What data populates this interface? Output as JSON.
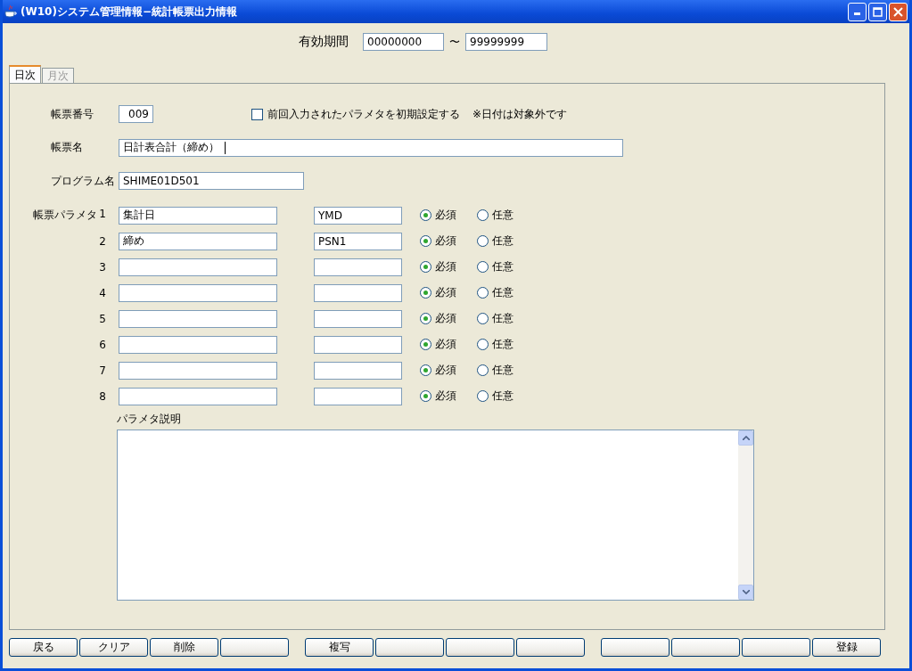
{
  "window": {
    "title": "(W10)システム管理情報−統計帳票出力情報"
  },
  "period": {
    "label": "有効期間",
    "from": "00000000",
    "separator": "〜",
    "to": "99999999"
  },
  "tabs": [
    {
      "label": "日次",
      "selected": true
    },
    {
      "label": "月次",
      "selected": false
    }
  ],
  "form": {
    "report_number": {
      "label": "帳票番号",
      "value": "009"
    },
    "reuse_checkbox": {
      "label": "前回入力されたパラメタを初期設定する",
      "checked": false,
      "note": "※日付は対象外です"
    },
    "report_name": {
      "label": "帳票名",
      "value": "日計表合計（締め）",
      "focused": true
    },
    "program_name": {
      "label": "プログラム名",
      "value": "SHIME01D501"
    },
    "parameters_label": "帳票パラメタ",
    "parameters": [
      {
        "number": "1",
        "name": "集計日",
        "code": "YMD",
        "options": [
          {
            "label": "必須",
            "selected": true
          },
          {
            "label": "任意",
            "selected": false
          }
        ]
      },
      {
        "number": "2",
        "name": "締め",
        "code": "PSN1",
        "options": [
          {
            "label": "必須",
            "selected": true
          },
          {
            "label": "任意",
            "selected": false
          }
        ]
      },
      {
        "number": "3",
        "options": [
          {
            "label": "必須",
            "selected": true
          },
          {
            "label": "任意",
            "selected": false
          }
        ]
      },
      {
        "number": "4",
        "options": [
          {
            "label": "必須",
            "selected": true
          },
          {
            "label": "任意",
            "selected": false
          }
        ]
      },
      {
        "number": "5",
        "options": [
          {
            "label": "必須",
            "selected": true
          },
          {
            "label": "任意",
            "selected": false
          }
        ]
      },
      {
        "number": "6",
        "options": [
          {
            "label": "必須",
            "selected": true
          },
          {
            "label": "任意",
            "selected": false
          }
        ]
      },
      {
        "number": "7",
        "options": [
          {
            "label": "必須",
            "selected": true
          },
          {
            "label": "任意",
            "selected": false
          }
        ]
      },
      {
        "number": "8",
        "options": [
          {
            "label": "必須",
            "selected": true
          },
          {
            "label": "任意",
            "selected": false
          }
        ]
      }
    ],
    "description": {
      "label": "パラメタ説明"
    }
  },
  "button_groups": [
    [
      {
        "kind": "labeled",
        "label": "戻る"
      },
      {
        "kind": "labeled",
        "label": "クリア"
      },
      {
        "kind": "labeled",
        "label": "削除"
      },
      {
        "kind": "blank"
      }
    ],
    [
      {
        "kind": "labeled",
        "label": "複写"
      },
      {
        "kind": "blank"
      },
      {
        "kind": "blank"
      },
      {
        "kind": "blank"
      }
    ],
    [
      {
        "kind": "blank"
      },
      {
        "kind": "blank"
      },
      {
        "kind": "blank"
      },
      {
        "kind": "labeled",
        "label": "登録"
      }
    ]
  ]
}
